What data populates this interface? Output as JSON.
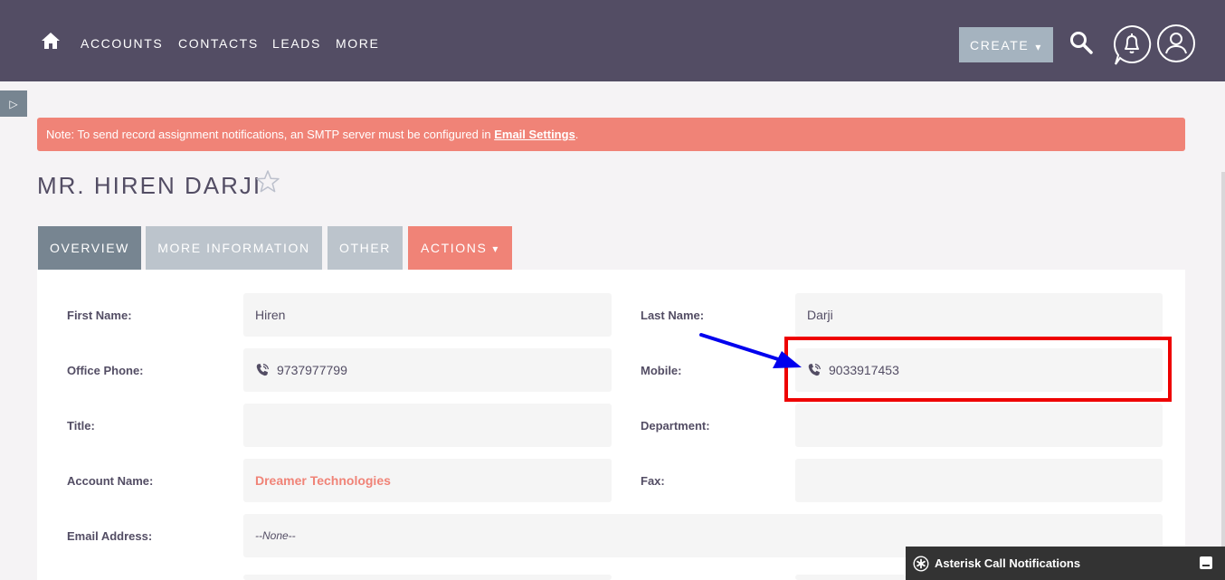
{
  "nav": {
    "items": [
      "ACCOUNTS",
      "CONTACTS",
      "LEADS",
      "MORE"
    ],
    "create_label": "CREATE",
    "caret": "▾"
  },
  "sidebar_toggle": "▷",
  "notice": {
    "text": "Note: To send record assignment notifications, an SMTP server must be configured in ",
    "link": "Email Settings",
    "suffix": "."
  },
  "title": "MR. HIREN DARJI",
  "tabs": {
    "overview": "OVERVIEW",
    "more_information": "MORE INFORMATION",
    "other": "OTHER",
    "actions": "ACTIONS"
  },
  "fields": {
    "first_name": {
      "label": "First Name:",
      "value": "Hiren"
    },
    "last_name": {
      "label": "Last Name:",
      "value": "Darji"
    },
    "office_phone": {
      "label": "Office Phone:",
      "value": "9737977799"
    },
    "mobile": {
      "label": "Mobile:",
      "value": "9033917453"
    },
    "title": {
      "label": "Title:",
      "value": ""
    },
    "department": {
      "label": "Department:",
      "value": ""
    },
    "account_name": {
      "label": "Account Name:",
      "value": "Dreamer Technologies"
    },
    "fax": {
      "label": "Fax:",
      "value": ""
    },
    "email_address": {
      "label": "Email Address:",
      "value": "--None--"
    }
  },
  "notification_bar": {
    "title": "Asterisk Call Notifications"
  },
  "colors": {
    "navbar": "#534d64",
    "accent": "#f08377",
    "tab_active": "#778591",
    "tab_inactive": "#bcc4cc",
    "highlight_box": "#ee0000",
    "annotation_arrow": "#0000ee"
  }
}
